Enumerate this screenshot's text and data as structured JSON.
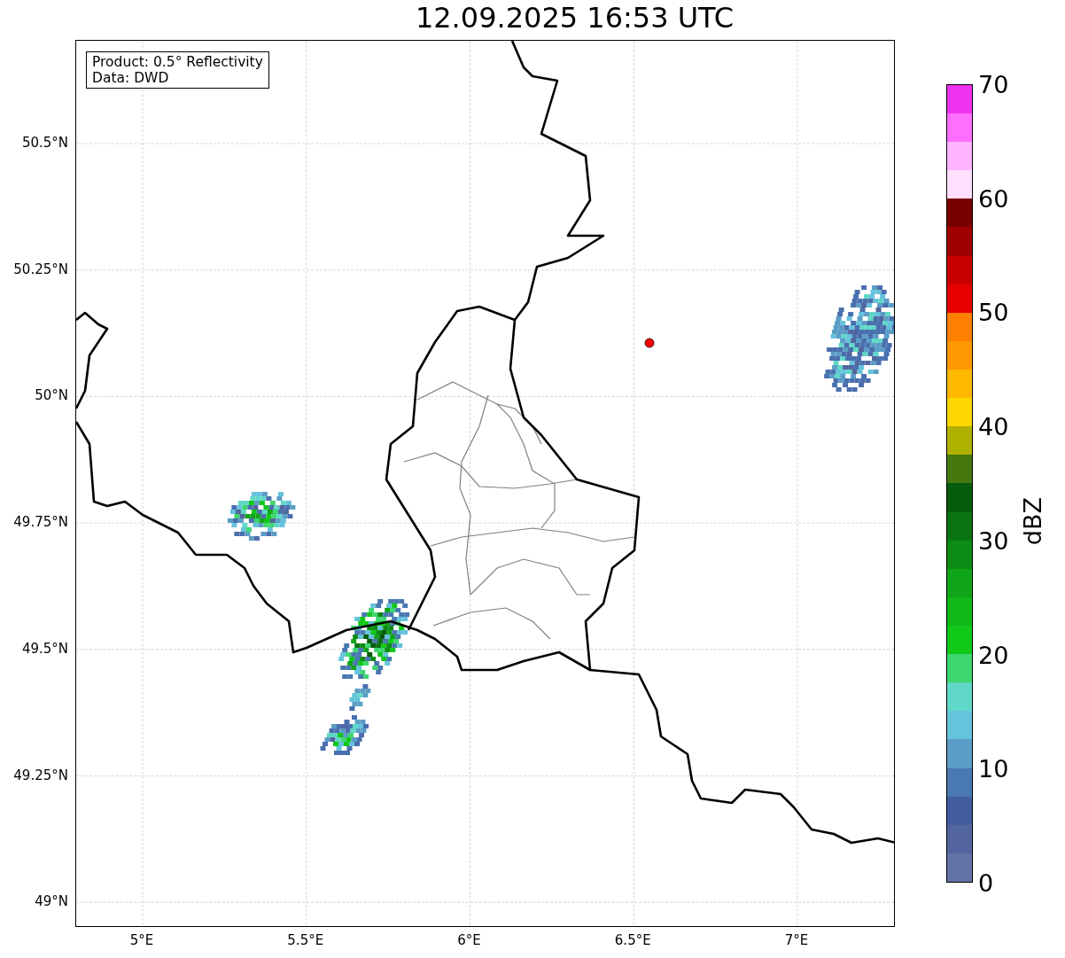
{
  "title": "12.09.2025 16:53 UTC",
  "info_box": {
    "lines": [
      "Product: 0.5° Reflectivity",
      "Data: DWD"
    ]
  },
  "map": {
    "lat_ticks": [
      "50.5°N",
      "50.25°N",
      "50°N",
      "49.75°N",
      "49.5°N",
      "49.25°N",
      "49°N"
    ],
    "lon_ticks": [
      "5°E",
      "5.5°E",
      "6°E",
      "6.5°E",
      "7°E"
    ]
  },
  "colorbar": {
    "label": "dBZ",
    "ticks": [
      "70",
      "60",
      "50",
      "40",
      "30",
      "20",
      "10",
      "0"
    ],
    "bins": [
      {
        "color": "#6473a6"
      },
      {
        "color": "#52659e"
      },
      {
        "color": "#425da0"
      },
      {
        "color": "#4a78b0"
      },
      {
        "color": "#5b9dc6"
      },
      {
        "color": "#65c3dc"
      },
      {
        "color": "#60d8c8"
      },
      {
        "color": "#3ed66e"
      },
      {
        "color": "#10c818"
      },
      {
        "color": "#10b818"
      },
      {
        "color": "#10a418"
      },
      {
        "color": "#0c8c14"
      },
      {
        "color": "#0a7412"
      },
      {
        "color": "#065c0c"
      },
      {
        "color": "#467810"
      },
      {
        "color": "#b0b000"
      },
      {
        "color": "#ffd700"
      },
      {
        "color": "#ffb800"
      },
      {
        "color": "#ff9800"
      },
      {
        "color": "#ff7f00"
      },
      {
        "color": "#e60000"
      },
      {
        "color": "#c80000"
      },
      {
        "color": "#a00000"
      },
      {
        "color": "#780000"
      },
      {
        "color": "#ffe0ff"
      },
      {
        "color": "#ffb4ff"
      },
      {
        "color": "#ff6eff"
      },
      {
        "color": "#ee33ee"
      }
    ]
  }
}
